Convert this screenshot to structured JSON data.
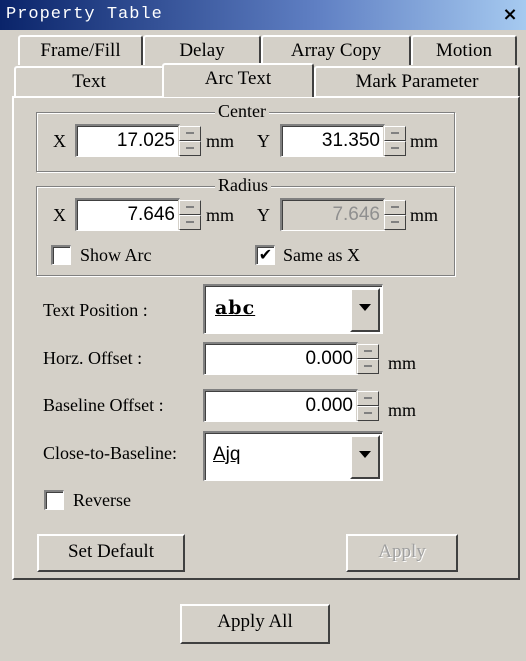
{
  "window": {
    "title": "Property Table",
    "close_glyph": "×"
  },
  "tabs_row1": [
    "Frame/Fill",
    "Delay",
    "Array Copy",
    "Motion"
  ],
  "tabs_row2": [
    "Text",
    "Arc Text",
    "Mark Parameter"
  ],
  "active_tab": "Arc Text",
  "center": {
    "legend": "Center",
    "x_label": "X",
    "x_value": "17.025",
    "x_unit": "mm",
    "y_label": "Y",
    "y_value": "31.350",
    "y_unit": "mm"
  },
  "radius": {
    "legend": "Radius",
    "x_label": "X",
    "x_value": "7.646",
    "x_unit": "mm",
    "y_label": "Y",
    "y_value": "7.646",
    "y_unit": "mm",
    "show_arc_label": "Show Arc",
    "show_arc_checked": "",
    "same_as_x_label": "Same as X",
    "same_as_x_checked": "✔"
  },
  "text_position": {
    "label": "Text Position :",
    "selected": "abc"
  },
  "horz_offset": {
    "label": "Horz. Offset :",
    "value": "0.000",
    "unit": "mm"
  },
  "baseline_offset": {
    "label": "Baseline Offset :",
    "value": "0.000",
    "unit": "mm"
  },
  "close_to_baseline": {
    "label": "Close-to-Baseline:",
    "selected": "Ajq"
  },
  "reverse": {
    "label": "Reverse",
    "checked": ""
  },
  "buttons": {
    "set_default": "Set Default",
    "apply": "Apply",
    "apply_all": "Apply All"
  },
  "colors": {
    "face": "#d4d0c8",
    "title_start": "#0a246a",
    "title_end": "#a6caf0"
  }
}
